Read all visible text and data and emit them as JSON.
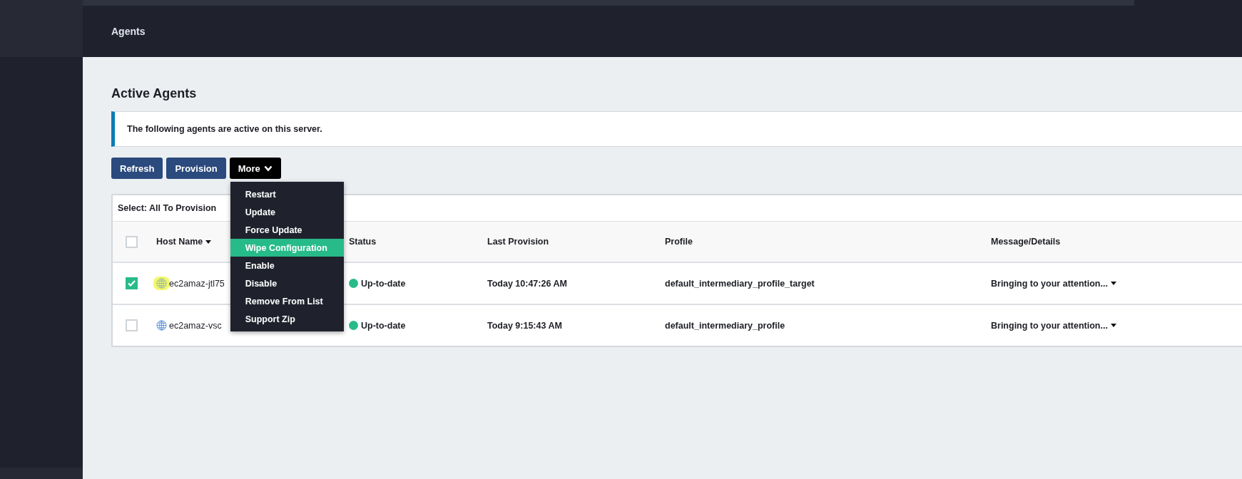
{
  "header": {
    "title": "Agents"
  },
  "page_title": "Active Agents",
  "info": "The following agents are active on this server.",
  "buttons": [
    {
      "label": "Refresh",
      "kind": "primary"
    },
    {
      "label": "Provision",
      "kind": "primary"
    },
    {
      "label": "More",
      "kind": "dropdown"
    }
  ],
  "menu": [
    {
      "label": "Restart",
      "selected": false
    },
    {
      "label": "Update",
      "selected": false
    },
    {
      "label": "Force Update",
      "selected": false
    },
    {
      "label": "Wipe Configuration",
      "selected": true
    },
    {
      "label": "Enable",
      "selected": false
    },
    {
      "label": "Disable",
      "selected": false
    },
    {
      "label": "Remove From List",
      "selected": false
    },
    {
      "label": "Support Zip",
      "selected": false
    }
  ],
  "table": {
    "select_label": "Select: All To Provision",
    "header_checked": false,
    "columns": [
      "Host Name",
      "Status",
      "Last Provision",
      "Profile",
      "Message/Details"
    ],
    "rows": [
      {
        "checked": true,
        "highlighted": true,
        "host": "ec2amaz-jtl75",
        "status": "Up-to-date",
        "last_provision": "Today 10:47:26 AM",
        "profile": "default_intermediary_profile_target",
        "message": "Bringing to your attention..."
      },
      {
        "checked": false,
        "highlighted": false,
        "host": "ec2amaz-vsc",
        "status": "Up-to-date",
        "last_provision": "Today 9:15:43 AM",
        "profile": "default_intermediary_profile",
        "message": "Bringing to your attention..."
      }
    ]
  }
}
